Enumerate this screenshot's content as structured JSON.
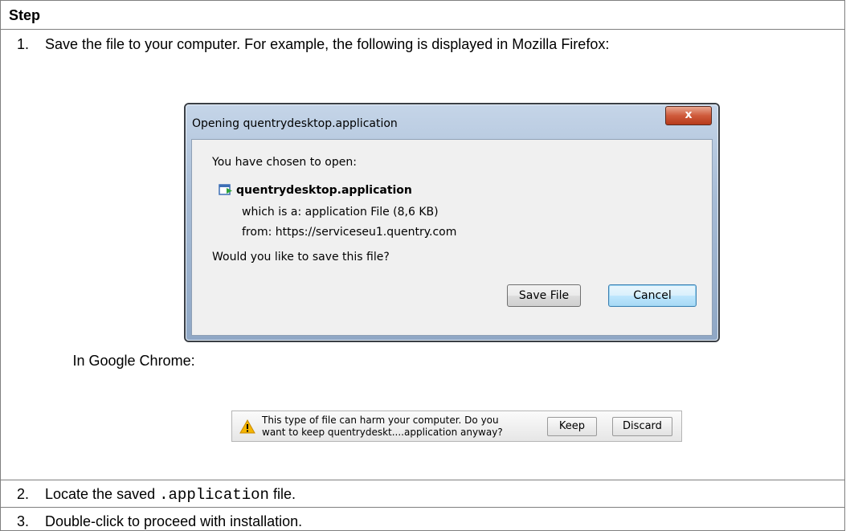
{
  "table": {
    "header": "Step",
    "steps": [
      {
        "number": "1.",
        "text": "Save the file to your computer. For example, the following is displayed in Mozilla Firefox:",
        "chrome_label": "In Google Chrome:"
      },
      {
        "number": "2.",
        "text_before": "Locate the saved ",
        "code": ".application",
        "text_after": " file."
      },
      {
        "number": "3.",
        "text": "Double-click to proceed with installation."
      }
    ]
  },
  "firefox_dialog": {
    "title": "Opening quentrydesktop.application",
    "close_label": "x",
    "chosen_label": "You have chosen to open:",
    "filename": "quentrydesktop.application",
    "which_is": "which is a:  application File (8,6 KB)",
    "from": "from:  https://serviceseu1.quentry.com",
    "question": "Would you like to save this file?",
    "save_button": "Save File",
    "cancel_button": "Cancel"
  },
  "chrome_bar": {
    "message_line1": "This type of file can harm your computer. Do you",
    "message_line2": "want to keep quentrydeskt....application anyway?",
    "keep_button": "Keep",
    "discard_button": "Discard",
    "warning_icon": "warning-icon"
  }
}
